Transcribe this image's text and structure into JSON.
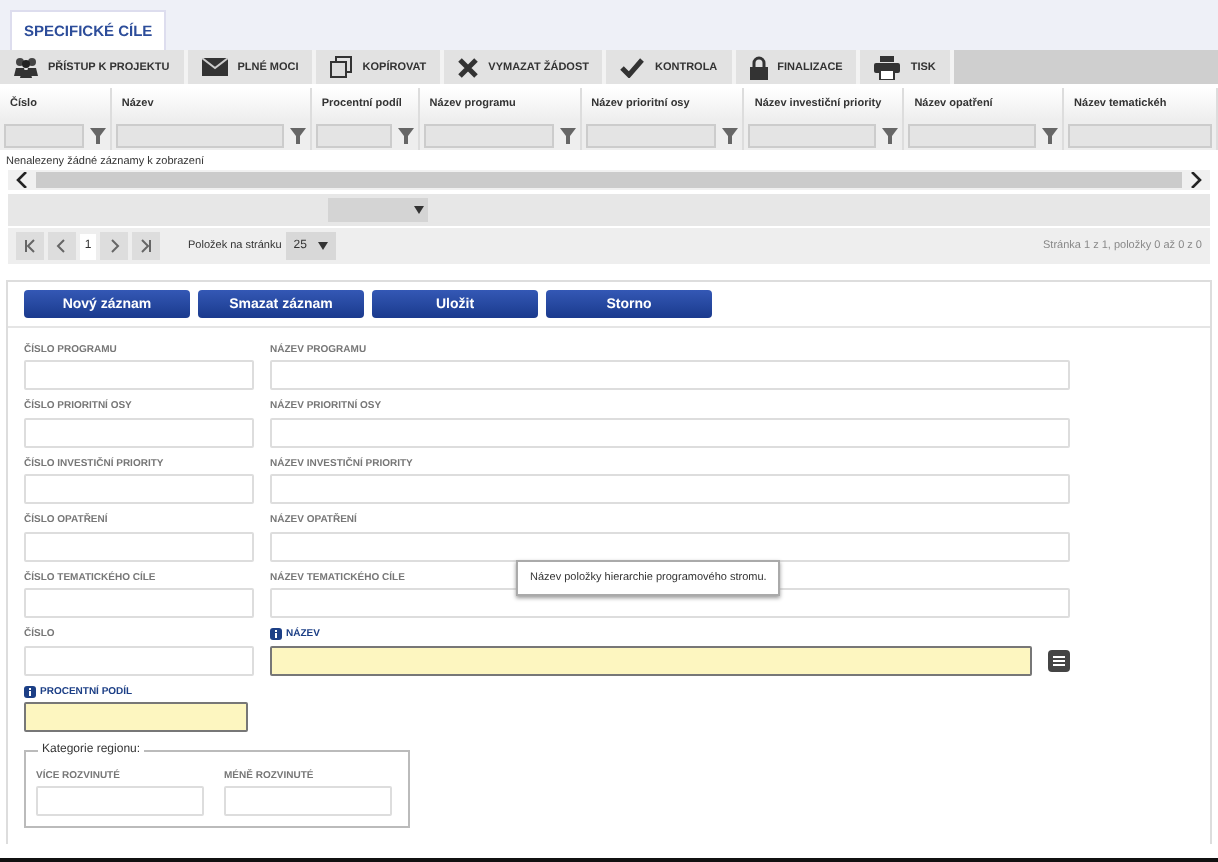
{
  "tabs": [
    {
      "label": "SPECIFICKÉ CÍLE",
      "selected": true
    }
  ],
  "toolbar": [
    {
      "label": "PŘÍSTUP K PROJEKTU",
      "kind": "people"
    },
    {
      "label": "PLNÉ MOCI",
      "kind": "mail"
    },
    {
      "label": "KOPÍROVAT",
      "kind": "copy"
    },
    {
      "label": "VYMAZAT ŽÁDOST",
      "kind": "cross"
    },
    {
      "label": "KONTROLA",
      "kind": "check"
    },
    {
      "label": "FINALIZACE",
      "kind": "lock"
    },
    {
      "label": "TISK",
      "kind": "print"
    }
  ],
  "table": {
    "columns": [
      "Číslo",
      "Název",
      "Procentní podíl",
      "Název programu",
      "Název prioritní osy",
      "Název investiční priority",
      "Název opatření",
      "Název tematickéh"
    ],
    "empty_message": "Nenalezeny žádné záznamy k zobrazení"
  },
  "pager": {
    "page": "1",
    "page_size_label": "Položek na stránku",
    "page_size": "25",
    "summary": "Stránka 1 z 1, položky 0 až 0 z 0"
  },
  "buttons": [
    "Nový záznam",
    "Smazat záznam",
    "Uložit",
    "Storno"
  ],
  "form": {
    "rows": [
      [
        {
          "label": "ČÍSLO PROGRAMU",
          "required": false
        },
        {
          "label": "NÁZEV PROGRAMU",
          "required": false
        }
      ],
      [
        {
          "label": "ČÍSLO PRIORITNÍ OSY",
          "required": false
        },
        {
          "label": "NÁZEV PRIORITNÍ OSY",
          "required": false
        }
      ],
      [
        {
          "label": "ČÍSLO INVESTIČNÍ PRIORITY",
          "required": false
        },
        {
          "label": "NÁZEV INVESTIČNÍ PRIORITY",
          "required": false
        }
      ],
      [
        {
          "label": "ČÍSLO OPATŘENÍ",
          "required": false
        },
        {
          "label": "NÁZEV OPATŘENÍ",
          "required": false
        }
      ],
      [
        {
          "label": "ČÍSLO TEMATICKÉHO CÍLE",
          "required": false
        },
        {
          "label": "NÁZEV TEMATICKÉHO CÍLE",
          "required": false
        }
      ],
      [
        {
          "label": "ČÍSLO",
          "required": false
        },
        {
          "label": "NÁZEV",
          "required": true,
          "picker": true
        }
      ],
      [
        {
          "label": "PROCENTNÍ PODÍL",
          "required": true
        }
      ]
    ],
    "tooltip": "Název položky hierarchie programového stromu.",
    "fieldset": {
      "legend": "Kategorie regionu:",
      "fields": [
        "VÍCE ROZVINUTÉ",
        "MÉNĚ ROZVINUTÉ"
      ]
    }
  }
}
